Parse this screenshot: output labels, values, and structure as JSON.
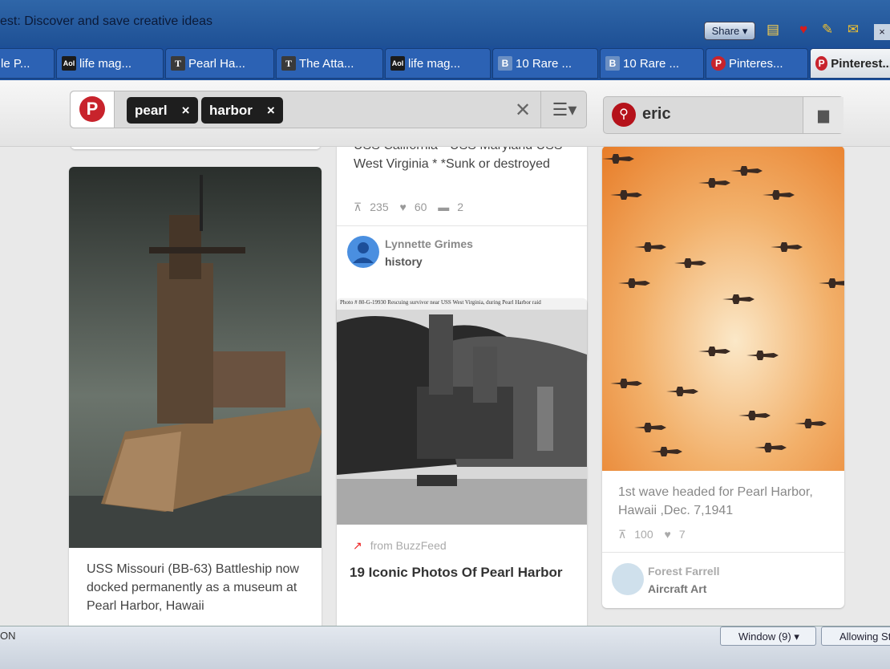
{
  "window": {
    "title": "est: Discover and save creative ideas"
  },
  "toolbar": {
    "share_label": "Share ▾"
  },
  "tabs": [
    {
      "label": "le P...",
      "icon": "none"
    },
    {
      "label": "life mag...",
      "icon": "aol"
    },
    {
      "label": "Pearl Ha...",
      "icon": "T"
    },
    {
      "label": "The Atta...",
      "icon": "T"
    },
    {
      "label": "life mag...",
      "icon": "aol"
    },
    {
      "label": "10 Rare ...",
      "icon": "B"
    },
    {
      "label": "10 Rare ...",
      "icon": "B"
    },
    {
      "label": "Pinteres...",
      "icon": "pinterest"
    },
    {
      "label": "Pinterest...",
      "icon": "pinterest",
      "active": true
    }
  ],
  "search": {
    "tokens": [
      "pearl",
      "harbor"
    ],
    "clear_label": "✕",
    "menu_label": "☰▾"
  },
  "user": {
    "name": "eric"
  },
  "pins": {
    "col2_top": {
      "description": "USS California * USS Maryland USS West Virginia * *Sunk or destroyed",
      "repins": "235",
      "likes": "60",
      "comments": "2",
      "user": "Lynnette Grimes",
      "board": "history"
    },
    "col1": {
      "description": "USS Missouri (BB-63) Battleship now docked permanently as a museum at Pearl Harbor, Hawaii"
    },
    "col2_bottom": {
      "caption": "Photo # 80-G-19930   Rescuing survivor near USS West Virginia, during Pearl Harbor raid",
      "source": "from BuzzFeed",
      "title": "19 Iconic Photos Of Pearl Harbor"
    },
    "col3": {
      "description": "1st wave headed for Pearl Harbor, Hawaii ,Dec. 7,1941",
      "repins": "100",
      "likes": "7",
      "user": "Forest Farrell",
      "board": "Aircraft Art"
    }
  },
  "statusbar": {
    "left": "ON",
    "window_label": "Window (9)",
    "allowing_label": "Allowing St"
  },
  "colors": {
    "pinterest_red": "#c8232c",
    "tab_blue": "#2c62b4"
  }
}
